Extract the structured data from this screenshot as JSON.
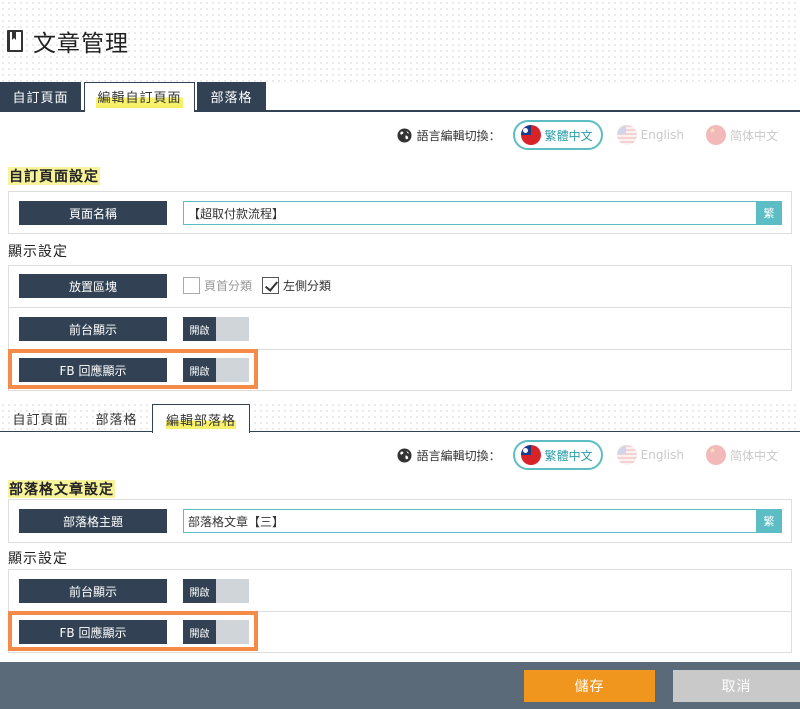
{
  "header": {
    "title": "文章管理",
    "icon": "book-icon"
  },
  "tabs_top": [
    {
      "label": "自訂頁面",
      "active": false
    },
    {
      "label": "編輯自訂頁面",
      "active": true
    },
    {
      "label": "部落格",
      "active": false
    }
  ],
  "tabs_bottom": [
    {
      "label": "自訂頁面",
      "active": false
    },
    {
      "label": "部落格",
      "active": false
    },
    {
      "label": "編輯部落格",
      "active": true
    }
  ],
  "lang_switch": {
    "label": "語言編輯切換：",
    "options": [
      {
        "label": "繁體中文",
        "flag": "taiwan-flag-icon",
        "active": true
      },
      {
        "label": "English",
        "flag": "usa-flag-icon",
        "active": false
      },
      {
        "label": "简体中文",
        "flag": "china-flag-icon",
        "active": false
      }
    ]
  },
  "custom_page": {
    "section_title": "自訂頁面設定",
    "page_name_label": "頁面名稱",
    "page_name_value": "【超取付款流程】",
    "lang_tag": "繁",
    "display_title": "顯示設定",
    "placement_label": "放置區塊",
    "placement_options": [
      {
        "label": "頁首分類",
        "checked": false
      },
      {
        "label": "左側分類",
        "checked": true
      }
    ],
    "frontend_label": "前台顯示",
    "frontend_toggle": "開啟",
    "fb_label": "FB 回應顯示",
    "fb_toggle": "開啟"
  },
  "blog": {
    "section_title": "部落格文章設定",
    "subject_label": "部落格主題",
    "subject_value": "部落格文章【三】",
    "lang_tag": "繁",
    "display_title": "顯示設定",
    "frontend_label": "前台顯示",
    "frontend_toggle": "開啟",
    "fb_label": "FB 回應顯示",
    "fb_toggle": "開啟"
  },
  "footer": {
    "save_label": "儲存",
    "cancel_label": "取消"
  },
  "colors": {
    "navy": "#324254",
    "teal": "#5dbdc4",
    "orange": "#f58b49",
    "save": "#f0961f"
  }
}
